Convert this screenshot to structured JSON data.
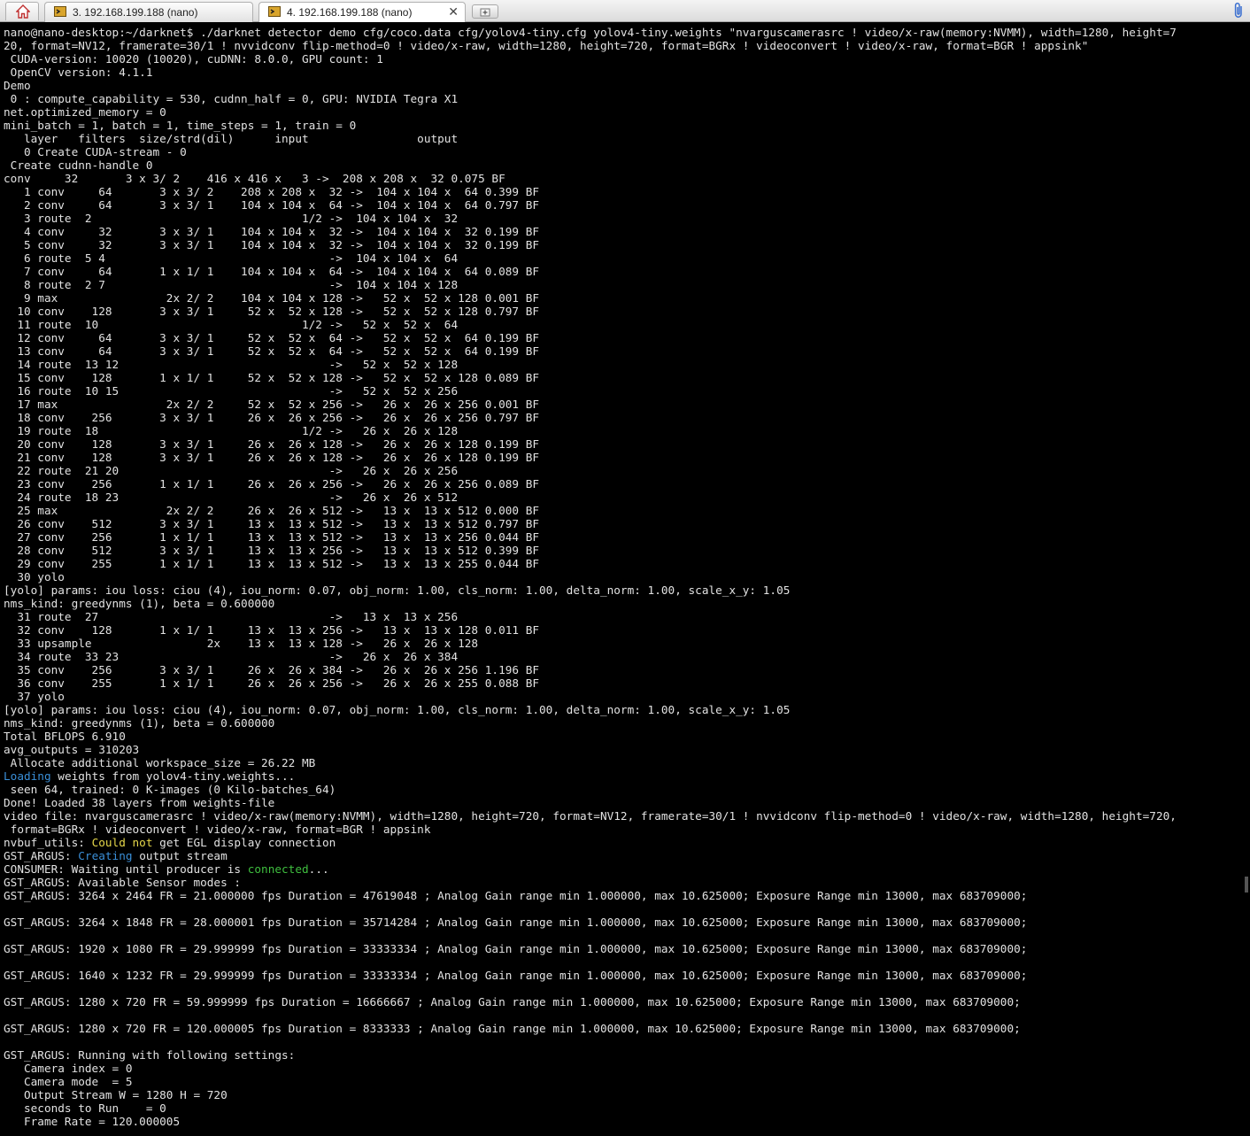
{
  "tabs": [
    {
      "label": "3. 192.168.199.188 (nano)",
      "icon": "terminal-icon"
    },
    {
      "label": "4. 192.168.199.188 (nano)",
      "icon": "terminal-icon",
      "close": "✕"
    }
  ],
  "terminal": {
    "lines": [
      "nano@nano-desktop:~/darknet$ ./darknet detector demo cfg/coco.data cfg/yolov4-tiny.cfg yolov4-tiny.weights \"nvarguscamerasrc ! video/x-raw(memory:NVMM), width=1280, height=7",
      "20, format=NV12, framerate=30/1 ! nvvidconv flip-method=0 ! video/x-raw, width=1280, height=720, format=BGRx ! videoconvert ! video/x-raw, format=BGR ! appsink\"",
      " CUDA-version: 10020 (10020), cuDNN: 8.0.0, GPU count: 1",
      " OpenCV version: 4.1.1",
      "Demo",
      " 0 : compute_capability = 530, cudnn_half = 0, GPU: NVIDIA Tegra X1",
      "net.optimized_memory = 0",
      "mini_batch = 1, batch = 1, time_steps = 1, train = 0",
      "   layer   filters  size/strd(dil)      input                output",
      "   0 Create CUDA-stream - 0",
      " Create cudnn-handle 0",
      "conv     32       3 x 3/ 2    416 x 416 x   3 ->  208 x 208 x  32 0.075 BF",
      "   1 conv     64       3 x 3/ 2    208 x 208 x  32 ->  104 x 104 x  64 0.399 BF",
      "   2 conv     64       3 x 3/ 1    104 x 104 x  64 ->  104 x 104 x  64 0.797 BF",
      "   3 route  2                               1/2 ->  104 x 104 x  32",
      "   4 conv     32       3 x 3/ 1    104 x 104 x  32 ->  104 x 104 x  32 0.199 BF",
      "   5 conv     32       3 x 3/ 1    104 x 104 x  32 ->  104 x 104 x  32 0.199 BF",
      "   6 route  5 4                                 ->  104 x 104 x  64",
      "   7 conv     64       1 x 1/ 1    104 x 104 x  64 ->  104 x 104 x  64 0.089 BF",
      "   8 route  2 7                                 ->  104 x 104 x 128",
      "   9 max                2x 2/ 2    104 x 104 x 128 ->   52 x  52 x 128 0.001 BF",
      "  10 conv    128       3 x 3/ 1     52 x  52 x 128 ->   52 x  52 x 128 0.797 BF",
      "  11 route  10                              1/2 ->   52 x  52 x  64",
      "  12 conv     64       3 x 3/ 1     52 x  52 x  64 ->   52 x  52 x  64 0.199 BF",
      "  13 conv     64       3 x 3/ 1     52 x  52 x  64 ->   52 x  52 x  64 0.199 BF",
      "  14 route  13 12                               ->   52 x  52 x 128",
      "  15 conv    128       1 x 1/ 1     52 x  52 x 128 ->   52 x  52 x 128 0.089 BF",
      "  16 route  10 15                               ->   52 x  52 x 256",
      "  17 max                2x 2/ 2     52 x  52 x 256 ->   26 x  26 x 256 0.001 BF",
      "  18 conv    256       3 x 3/ 1     26 x  26 x 256 ->   26 x  26 x 256 0.797 BF",
      "  19 route  18                              1/2 ->   26 x  26 x 128",
      "  20 conv    128       3 x 3/ 1     26 x  26 x 128 ->   26 x  26 x 128 0.199 BF",
      "  21 conv    128       3 x 3/ 1     26 x  26 x 128 ->   26 x  26 x 128 0.199 BF",
      "  22 route  21 20                               ->   26 x  26 x 256",
      "  23 conv    256       1 x 1/ 1     26 x  26 x 256 ->   26 x  26 x 256 0.089 BF",
      "  24 route  18 23                               ->   26 x  26 x 512",
      "  25 max                2x 2/ 2     26 x  26 x 512 ->   13 x  13 x 512 0.000 BF",
      "  26 conv    512       3 x 3/ 1     13 x  13 x 512 ->   13 x  13 x 512 0.797 BF",
      "  27 conv    256       1 x 1/ 1     13 x  13 x 512 ->   13 x  13 x 256 0.044 BF",
      "  28 conv    512       3 x 3/ 1     13 x  13 x 256 ->   13 x  13 x 512 0.399 BF",
      "  29 conv    255       1 x 1/ 1     13 x  13 x 512 ->   13 x  13 x 255 0.044 BF",
      "  30 yolo",
      "[yolo] params: iou loss: ciou (4), iou_norm: 0.07, obj_norm: 1.00, cls_norm: 1.00, delta_norm: 1.00, scale_x_y: 1.05",
      "nms_kind: greedynms (1), beta = 0.600000",
      "  31 route  27                                  ->   13 x  13 x 256",
      "  32 conv    128       1 x 1/ 1     13 x  13 x 256 ->   13 x  13 x 128 0.011 BF",
      "  33 upsample                 2x    13 x  13 x 128 ->   26 x  26 x 128",
      "  34 route  33 23                               ->   26 x  26 x 384",
      "  35 conv    256       3 x 3/ 1     26 x  26 x 384 ->   26 x  26 x 256 1.196 BF",
      "  36 conv    255       1 x 1/ 1     26 x  26 x 256 ->   26 x  26 x 255 0.088 BF",
      "  37 yolo",
      "[yolo] params: iou loss: ciou (4), iou_norm: 0.07, obj_norm: 1.00, cls_norm: 1.00, delta_norm: 1.00, scale_x_y: 1.05",
      "nms_kind: greedynms (1), beta = 0.600000",
      "Total BFLOPS 6.910",
      "avg_outputs = 310203",
      " Allocate additional workspace_size = 26.22 MB",
      [
        {
          "t": "Loading",
          "c": "c-blue"
        },
        {
          "t": " weights from yolov4-tiny.weights..."
        }
      ],
      " seen 64, trained: 0 K-images (0 Kilo-batches_64)",
      "Done! Loaded 38 layers from weights-file",
      "video file: nvarguscamerasrc ! video/x-raw(memory:NVMM), width=1280, height=720, format=NV12, framerate=30/1 ! nvvidconv flip-method=0 ! video/x-raw, width=1280, height=720,",
      " format=BGRx ! videoconvert ! video/x-raw, format=BGR ! appsink",
      [
        {
          "t": "nvbuf_utils: "
        },
        {
          "t": "Could not",
          "c": "c-yellow"
        },
        {
          "t": " get EGL display connection"
        }
      ],
      [
        {
          "t": "GST_ARGUS: "
        },
        {
          "t": "Creating",
          "c": "c-blue"
        },
        {
          "t": " output stream"
        }
      ],
      [
        {
          "t": "CONSUMER: Waiting until producer is "
        },
        {
          "t": "connected",
          "c": "c-green"
        },
        {
          "t": "..."
        }
      ],
      "GST_ARGUS: Available Sensor modes :",
      "GST_ARGUS: 3264 x 2464 FR = 21.000000 fps Duration = 47619048 ; Analog Gain range min 1.000000, max 10.625000; Exposure Range min 13000, max 683709000;",
      "",
      "GST_ARGUS: 3264 x 1848 FR = 28.000001 fps Duration = 35714284 ; Analog Gain range min 1.000000, max 10.625000; Exposure Range min 13000, max 683709000;",
      "",
      "GST_ARGUS: 1920 x 1080 FR = 29.999999 fps Duration = 33333334 ; Analog Gain range min 1.000000, max 10.625000; Exposure Range min 13000, max 683709000;",
      "",
      "GST_ARGUS: 1640 x 1232 FR = 29.999999 fps Duration = 33333334 ; Analog Gain range min 1.000000, max 10.625000; Exposure Range min 13000, max 683709000;",
      "",
      "GST_ARGUS: 1280 x 720 FR = 59.999999 fps Duration = 16666667 ; Analog Gain range min 1.000000, max 10.625000; Exposure Range min 13000, max 683709000;",
      "",
      "GST_ARGUS: 1280 x 720 FR = 120.000005 fps Duration = 8333333 ; Analog Gain range min 1.000000, max 10.625000; Exposure Range min 13000, max 683709000;",
      "",
      "GST_ARGUS: Running with following settings:",
      "   Camera index = 0",
      "   Camera mode  = 5",
      "   Output Stream W = 1280 H = 720",
      "   seconds to Run    = 0",
      "   Frame Rate = 120.000005"
    ]
  }
}
